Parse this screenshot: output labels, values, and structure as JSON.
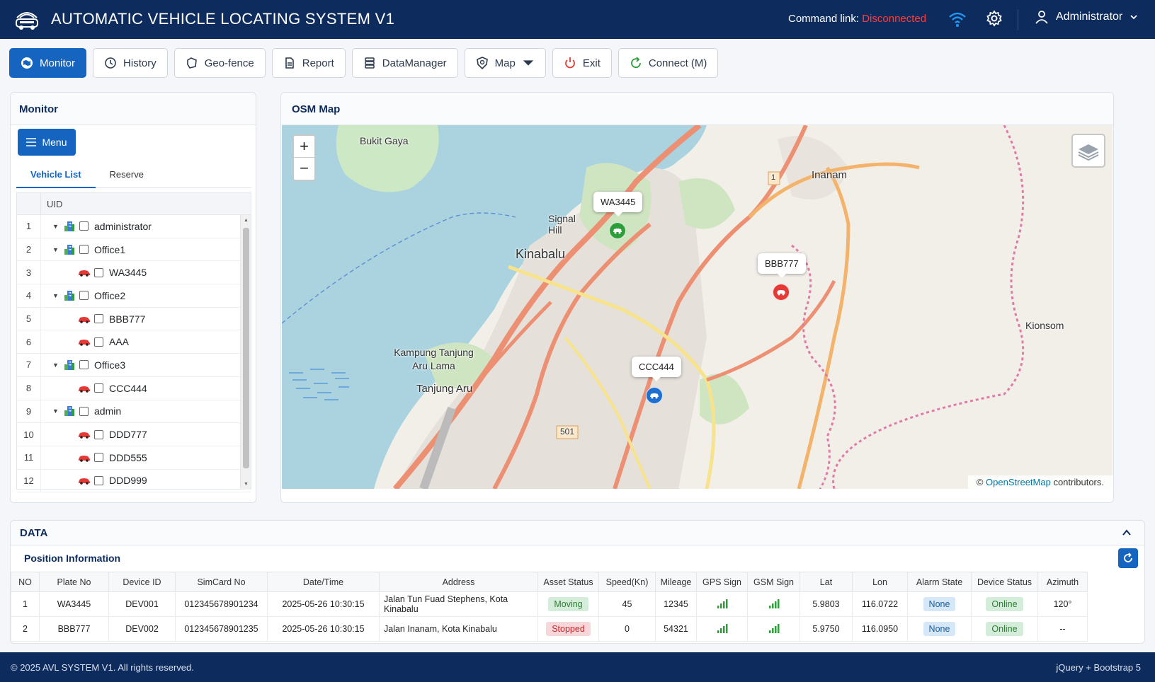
{
  "header": {
    "title": "AUTOMATIC VEHICLE LOCATING SYSTEM V1",
    "command_link_label": "Command link:",
    "command_link_status": "Disconnected",
    "user": "Administrator"
  },
  "toolbar": [
    {
      "label": "Monitor",
      "icon": "shield-map-icon",
      "active": true
    },
    {
      "label": "History",
      "icon": "history-icon"
    },
    {
      "label": "Geo-fence",
      "icon": "geofence-icon"
    },
    {
      "label": "Report",
      "icon": "report-icon"
    },
    {
      "label": "DataManager",
      "icon": "database-icon"
    },
    {
      "label": "Map",
      "icon": "map-shield-icon",
      "dropdown": true
    },
    {
      "label": "Exit",
      "icon": "power-icon"
    },
    {
      "label": "Connect (M)",
      "icon": "refresh-icon"
    }
  ],
  "monitor": {
    "title": "Monitor",
    "menu_label": "Menu",
    "tabs": [
      "Vehicle List",
      "Reserve"
    ],
    "tree_header": "UID",
    "rows": [
      {
        "no": "1",
        "label": "administrator",
        "type": "group",
        "level": 0
      },
      {
        "no": "2",
        "label": "Office1",
        "type": "group",
        "level": 0
      },
      {
        "no": "3",
        "label": "WA3445",
        "type": "vehicle",
        "level": 1
      },
      {
        "no": "4",
        "label": "Office2",
        "type": "group",
        "level": 0
      },
      {
        "no": "5",
        "label": "BBB777",
        "type": "vehicle",
        "level": 1
      },
      {
        "no": "6",
        "label": "AAA",
        "type": "vehicle",
        "level": 1
      },
      {
        "no": "7",
        "label": "Office3",
        "type": "group",
        "level": 0
      },
      {
        "no": "8",
        "label": "CCC444",
        "type": "vehicle",
        "level": 1
      },
      {
        "no": "9",
        "label": "admin",
        "type": "group",
        "level": 0
      },
      {
        "no": "10",
        "label": "DDD777",
        "type": "vehicle",
        "level": 1
      },
      {
        "no": "11",
        "label": "DDD555",
        "type": "vehicle",
        "level": 1
      },
      {
        "no": "12",
        "label": "DDD999",
        "type": "vehicle",
        "level": 1
      }
    ]
  },
  "map": {
    "title": "OSM Map",
    "zoom_in": "+",
    "zoom_out": "−",
    "attribution_prefix": "©",
    "attribution_link": "OpenStreetMap",
    "attribution_suffix": "contributors.",
    "places": [
      "Bukit Gaya",
      "Inanam",
      "Signal Hill",
      "Kinabalu",
      "Kionsom",
      "Kampung Tanjung Aru Lama",
      "Tanjung Aru",
      "501",
      "1"
    ],
    "vehicles": [
      {
        "label": "WA3445",
        "color": "#2e9e3a"
      },
      {
        "label": "BBB777",
        "color": "#e53935"
      },
      {
        "label": "CCC444",
        "color": "#1e6fd0"
      }
    ]
  },
  "data": {
    "title": "DATA",
    "subtitle": "Position Information",
    "columns": [
      "NO",
      "Plate No",
      "Device ID",
      "SimCard No",
      "Date/Time",
      "Address",
      "Asset Status",
      "Speed(Kn)",
      "Mileage",
      "GPS Sign",
      "GSM Sign",
      "Lat",
      "Lon",
      "Alarm State",
      "Device Status",
      "Azimuth"
    ],
    "rows": [
      [
        "1",
        "WA3445",
        "DEV001",
        "012345678901234",
        "2025-05-26 10:30:15",
        "Jalan Tun Fuad Stephens, Kota Kinabalu",
        "Moving",
        "45",
        "12345",
        "",
        "",
        "5.9803",
        "116.0722",
        "None",
        "Online",
        "120°"
      ],
      [
        "2",
        "BBB777",
        "DEV002",
        "012345678901235",
        "2025-05-26 10:30:15",
        "Jalan Inanam, Kota Kinabalu",
        "Stopped",
        "0",
        "54321",
        "",
        "",
        "5.9750",
        "116.0950",
        "None",
        "Online",
        "--"
      ]
    ]
  },
  "footer": {
    "copyright": "© 2025 AVL SYSTEM V1. All rights reserved.",
    "tech": "jQuery + Bootstrap 5"
  }
}
